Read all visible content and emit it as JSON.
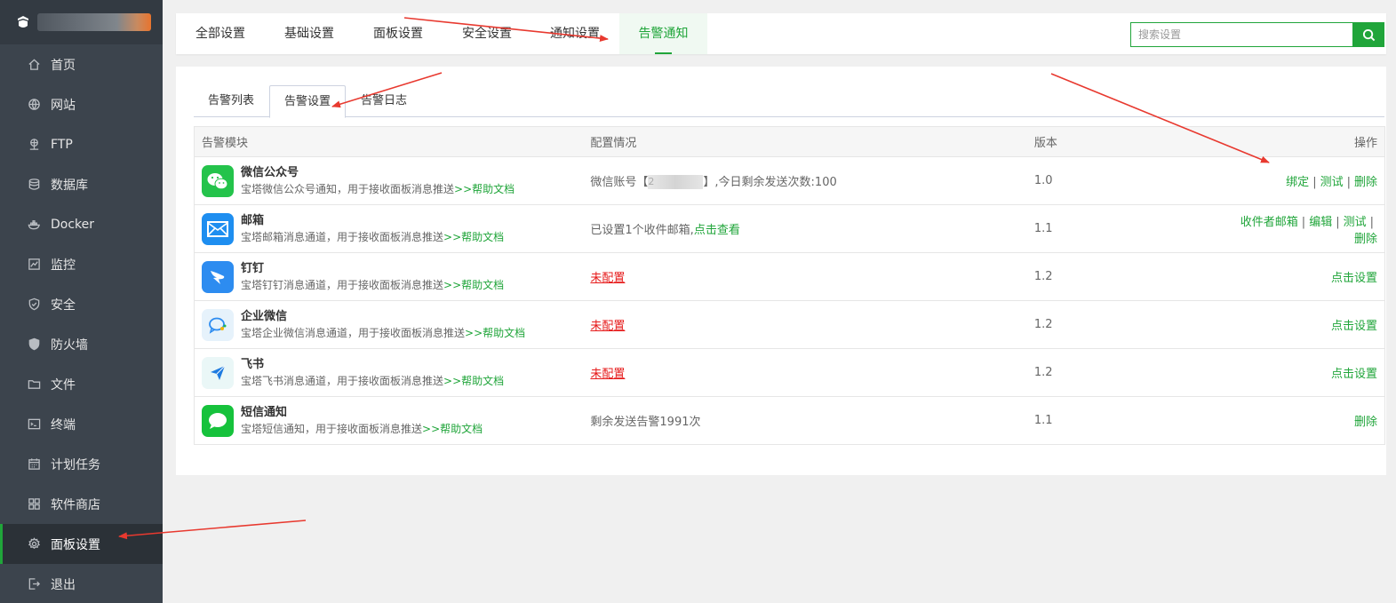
{
  "sidebar": {
    "brand_name": "1",
    "items": [
      {
        "label": "首页",
        "icon": "home-icon"
      },
      {
        "label": "网站",
        "icon": "globe-icon"
      },
      {
        "label": "FTP",
        "icon": "ftp-icon"
      },
      {
        "label": "数据库",
        "icon": "database-icon"
      },
      {
        "label": "Docker",
        "icon": "docker-icon"
      },
      {
        "label": "监控",
        "icon": "monitor-icon"
      },
      {
        "label": "安全",
        "icon": "shield-check-icon"
      },
      {
        "label": "防火墙",
        "icon": "firewall-icon"
      },
      {
        "label": "文件",
        "icon": "folder-icon"
      },
      {
        "label": "终端",
        "icon": "terminal-icon"
      },
      {
        "label": "计划任务",
        "icon": "calendar-icon"
      },
      {
        "label": "软件商店",
        "icon": "apps-icon"
      },
      {
        "label": "面板设置",
        "icon": "gear-icon",
        "active": true
      },
      {
        "label": "退出",
        "icon": "logout-icon"
      }
    ]
  },
  "top_tabs": [
    "全部设置",
    "基础设置",
    "面板设置",
    "安全设置",
    "通知设置",
    "告警通知"
  ],
  "top_tab_active": "告警通知",
  "search": {
    "placeholder": "搜索设置"
  },
  "sub_tabs": [
    "告警列表",
    "告警设置",
    "告警日志"
  ],
  "sub_tab_active": "告警设置",
  "table": {
    "headers": [
      "告警模块",
      "配置情况",
      "版本",
      "操作"
    ],
    "rows": [
      {
        "icon": "wechat-icon",
        "icon_color": "#24c34b",
        "title": "微信公众号",
        "desc": "宝塔微信公众号通知，用于接收面板消息推送",
        "help": ">>帮助文档",
        "config_prefix": "微信账号【",
        "config_suffix": "】,今日剩余发送次数:100",
        "config_masked": "2",
        "version": "1.0",
        "actions": [
          "绑定",
          "测试",
          "删除"
        ]
      },
      {
        "icon": "mail-icon",
        "icon_color": "#1e8ef0",
        "title": "邮箱",
        "desc": "宝塔邮箱消息通道，用于接收面板消息推送",
        "help": ">>帮助文档",
        "config_text": "已设置1个收件邮箱,",
        "config_link": "点击查看",
        "version": "1.1",
        "actions": [
          "收件者邮箱",
          "编辑",
          "测试",
          "删除"
        ]
      },
      {
        "icon": "dingtalk-icon",
        "icon_color": "#2d8cf0",
        "title": "钉钉",
        "desc": "宝塔钉钉消息通道，用于接收面板消息推送",
        "help": ">>帮助文档",
        "config_unset": "未配置",
        "version": "1.2",
        "actions": [
          "点击设置"
        ]
      },
      {
        "icon": "wework-icon",
        "icon_color": "#e6f2fb",
        "title": "企业微信",
        "desc": "宝塔企业微信消息通道，用于接收面板消息推送",
        "help": ">>帮助文档",
        "config_unset": "未配置",
        "version": "1.2",
        "actions": [
          "点击设置"
        ]
      },
      {
        "icon": "feishu-icon",
        "icon_color": "#eaf7f7",
        "title": "飞书",
        "desc": "宝塔飞书消息通道，用于接收面板消息推送",
        "help": ">>帮助文档",
        "config_unset": "未配置",
        "version": "1.2",
        "actions": [
          "点击设置"
        ]
      },
      {
        "icon": "sms-icon",
        "icon_color": "#16c23c",
        "title": "短信通知",
        "desc": "宝塔短信通知，用于接收面板消息推送",
        "help": ">>帮助文档",
        "config_text": "剩余发送告警1991次",
        "version": "1.1",
        "actions": [
          "删除"
        ]
      }
    ]
  },
  "colors": {
    "accent": "#20a53a",
    "sidebar": "#3c444d",
    "annotation_arrow": "#e8392f",
    "danger": "#e61a1a"
  }
}
